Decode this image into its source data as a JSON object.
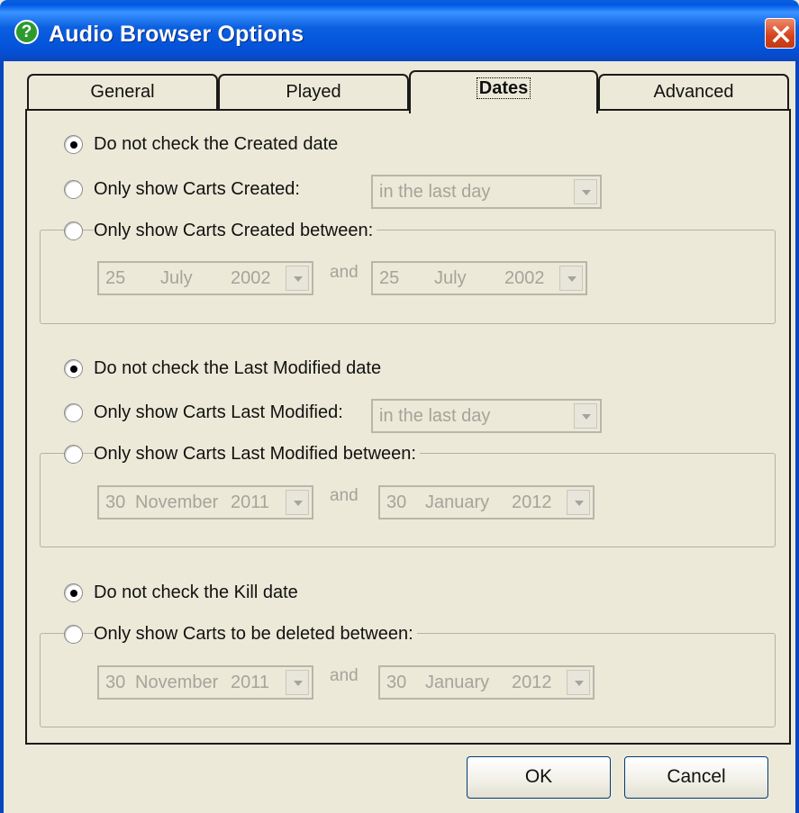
{
  "window": {
    "title": "Audio Browser Options",
    "help_glyph": "?",
    "icons": {
      "help": "help-icon",
      "close": "close-icon"
    }
  },
  "tabs": [
    {
      "label": "General",
      "active": false
    },
    {
      "label": "Played",
      "active": false
    },
    {
      "label": "Dates",
      "active": true
    },
    {
      "label": "Advanced",
      "active": false
    }
  ],
  "created": {
    "no_check_label": "Do not check the Created date",
    "only_show_label": "Only show Carts Created:",
    "period_value": "in the last day",
    "between_label": "Only show Carts Created between:",
    "from": {
      "day": "25",
      "month": "July",
      "year": "2002"
    },
    "to": {
      "day": "25",
      "month": "July",
      "year": "2002"
    },
    "and_label": "and"
  },
  "modified": {
    "no_check_label": "Do not check the Last Modified date",
    "only_show_label": "Only show Carts Last Modified:",
    "period_value": "in the last day",
    "between_label": "Only show Carts Last Modified between:",
    "from": {
      "day": "30",
      "month": "November",
      "year": "2011"
    },
    "to": {
      "day": "30",
      "month": "January",
      "year": "2012"
    },
    "and_label": "and"
  },
  "kill": {
    "no_check_label": "Do not check the Kill date",
    "between_label": "Only show Carts to be deleted between:",
    "from": {
      "day": "30",
      "month": "November",
      "year": "2011"
    },
    "to": {
      "day": "30",
      "month": "January",
      "year": "2012"
    },
    "and_label": "and"
  },
  "buttons": {
    "ok": "OK",
    "cancel": "Cancel"
  },
  "colors": {
    "titlebar": "#0058e6",
    "dialog_bg": "#ece9d8",
    "disabled_text": "#a5a49b",
    "close_button": "#d5431c"
  }
}
